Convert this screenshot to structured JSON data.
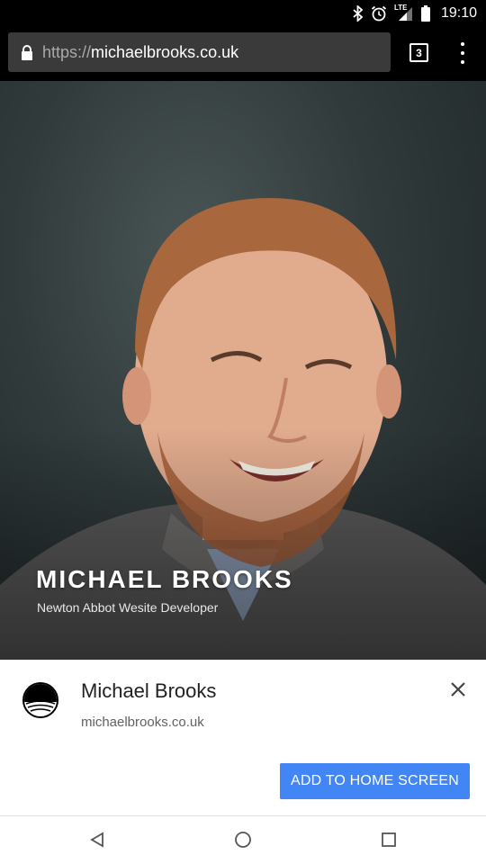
{
  "status_bar": {
    "time": "19:10",
    "network": "LTE",
    "icons": [
      "bluetooth-icon",
      "alarm-icon",
      "signal-icon",
      "battery-icon"
    ]
  },
  "browser": {
    "url_scheme": "https://",
    "url_host": "michaelbrooks.co.uk",
    "tab_count": "3"
  },
  "hero": {
    "name": "MICHAEL BROOKS",
    "tagline": "Newton Abbot Wesite Developer"
  },
  "install_banner": {
    "title": "Michael Brooks",
    "url": "michaelbrooks.co.uk",
    "add_button_label": "ADD TO HOME SCREEN",
    "accent_color": "#4285f4"
  },
  "nav": {
    "buttons": [
      "back-icon",
      "home-icon",
      "recents-icon"
    ]
  }
}
